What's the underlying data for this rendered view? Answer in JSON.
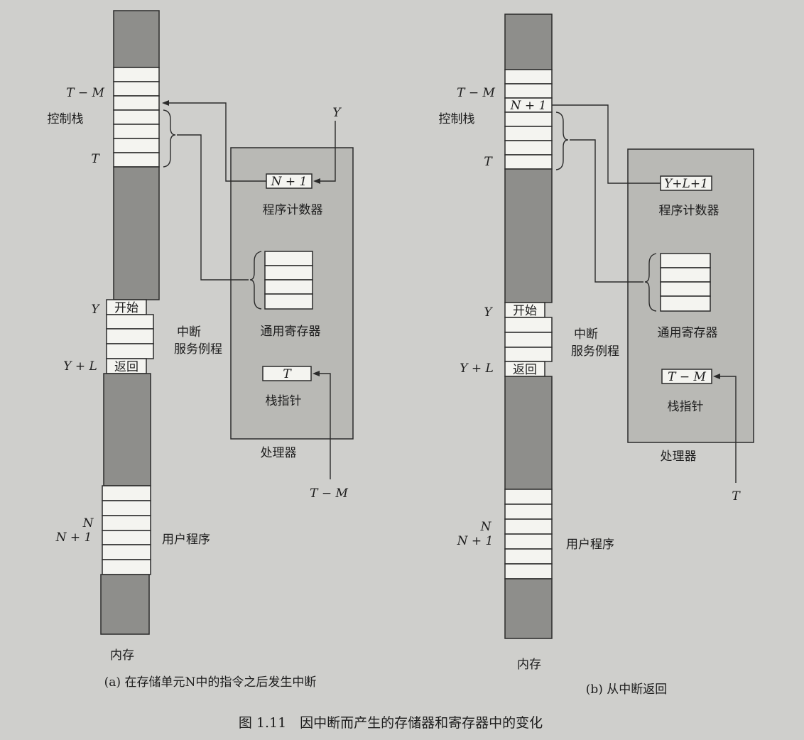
{
  "panel_a": {
    "memory_labels": {
      "t_minus_m": "T − M",
      "control_stack": "控制栈",
      "t": "T",
      "y": "Y",
      "y_plus_l": "Y + L",
      "n": "N",
      "n_plus_1": "N + 1"
    },
    "cell_texts": {
      "start": "开始",
      "return": "返回"
    },
    "isr_line1": "中断",
    "isr_line2": "服务例程",
    "user_program": "用户程序",
    "memory": "内存",
    "processor": {
      "pc_value": "N + 1",
      "pc_label": "程序计数器",
      "gpr_label": "通用寄存器",
      "sp_value": "T",
      "sp_label": "栈指针",
      "name": "处理器"
    },
    "arrow_y": "Y",
    "arrow_t_minus_m": "T − M",
    "caption": "(a) 在存储单元N中的指令之后发生中断"
  },
  "panel_b": {
    "memory_labels": {
      "t_minus_m": "T − M",
      "control_stack": "控制栈",
      "t": "T",
      "y": "Y",
      "y_plus_l": "Y + L",
      "n": "N",
      "n_plus_1": "N + 1"
    },
    "cell_texts": {
      "n_plus_1": "N + 1",
      "start": "开始",
      "return": "返回"
    },
    "isr_line1": "中断",
    "isr_line2": "服务例程",
    "user_program": "用户程序",
    "memory": "内存",
    "processor": {
      "pc_value": "Y+L+1",
      "pc_label": "程序计数器",
      "gpr_label": "通用寄存器",
      "sp_value": "T − M",
      "sp_label": "栈指针",
      "name": "处理器"
    },
    "arrow_t": "T",
    "caption": "(b) 从中断返回"
  },
  "figure_title": "图 1.11　因中断而产生的存储器和寄存器中的变化"
}
